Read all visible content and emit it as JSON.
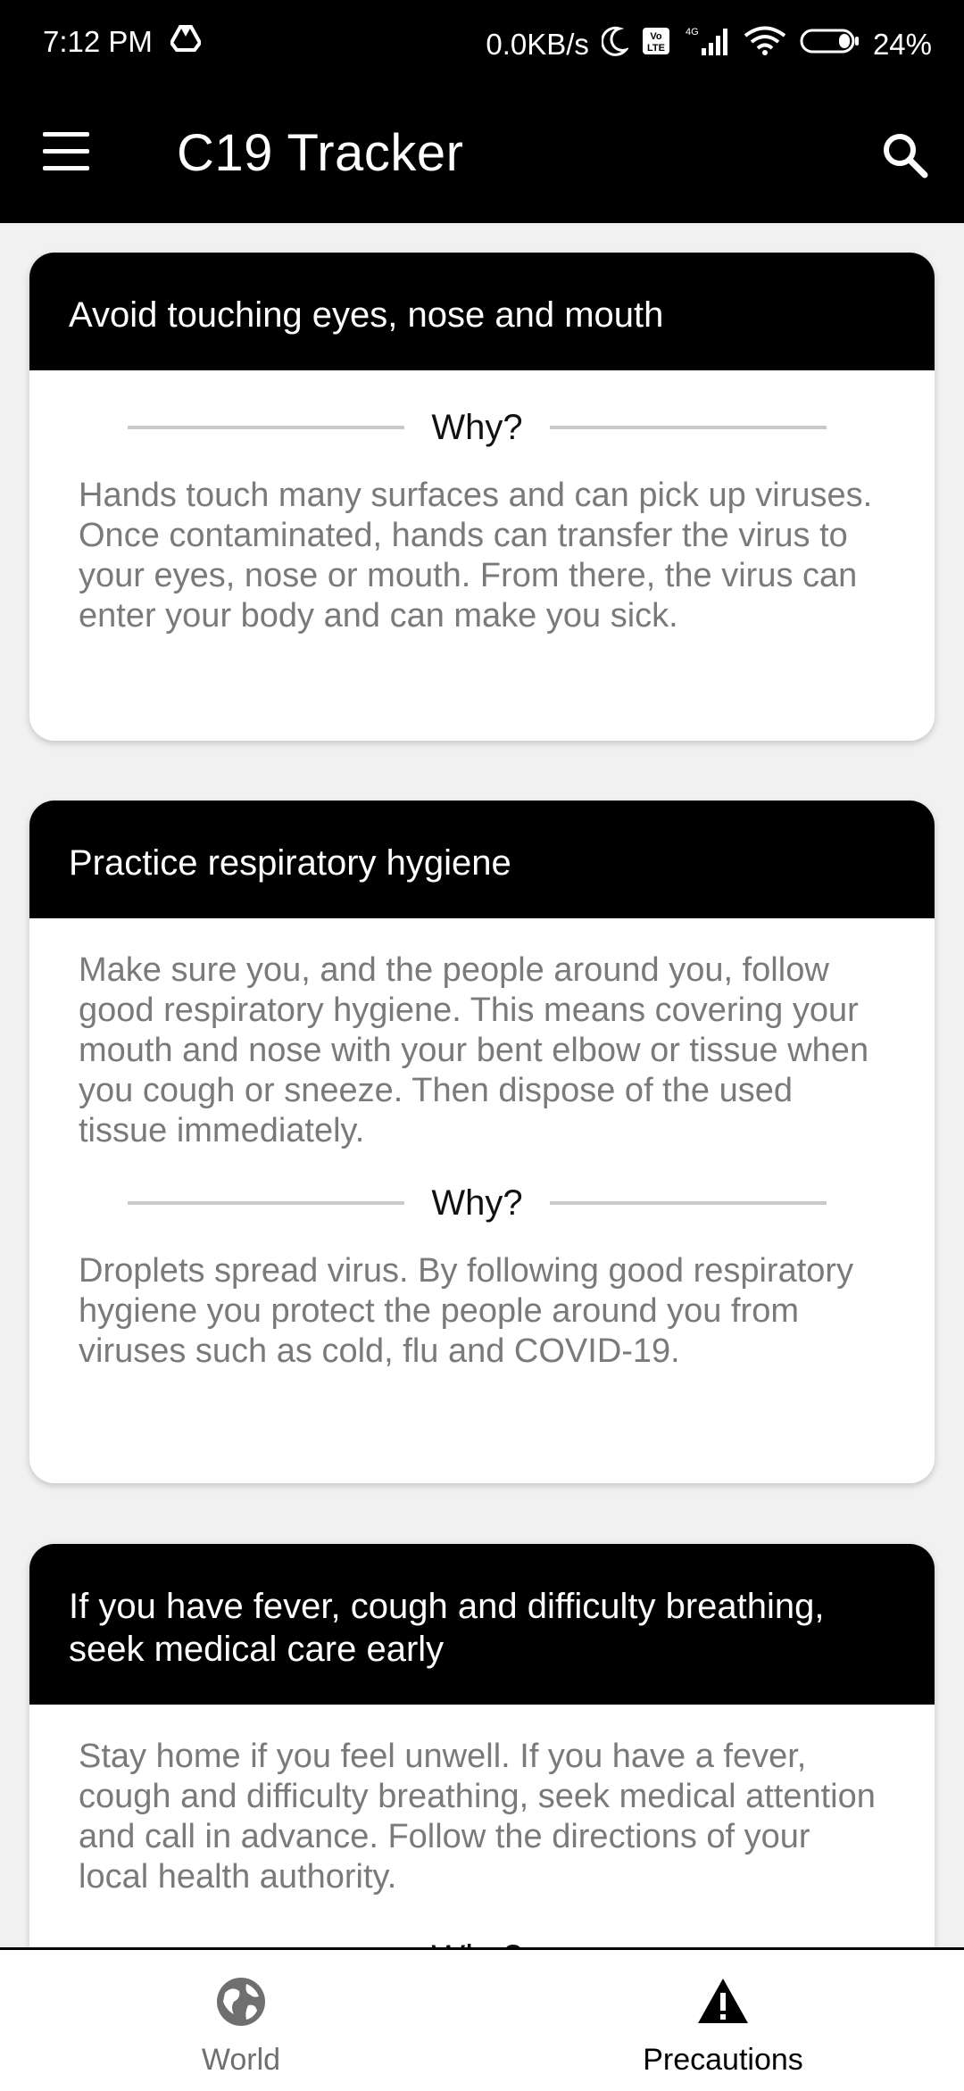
{
  "status_bar": {
    "time": "7:12 PM",
    "network_speed": "0.0KB/s",
    "battery": "24%",
    "icons": [
      "drive-icon",
      "moon-icon",
      "volte-icon",
      "signal-icon",
      "wifi-icon",
      "battery-icon"
    ]
  },
  "app_bar": {
    "title": "C19 Tracker",
    "menu_icon": "hamburger-menu-icon",
    "search_icon": "search-icon"
  },
  "cards": [
    {
      "title": "Avoid touching eyes, nose and mouth",
      "why_label": "Why?",
      "why_text": "Hands touch many surfaces and can pick up viruses. Once contaminated, hands can transfer the virus to your eyes, nose or mouth. From there, the virus can enter your body and can make you sick."
    },
    {
      "title": "Practice respiratory hygiene",
      "description": "Make sure you, and the people around you, follow good respiratory hygiene. This means covering your mouth and nose with your bent elbow or tissue when you cough or sneeze. Then dispose of the used tissue immediately.",
      "why_label": "Why?",
      "why_text": "Droplets spread virus. By following good respiratory hygiene you protect the people around you from viruses such as cold, flu and COVID-19."
    },
    {
      "title": "If you have fever, cough and difficulty breathing, seek medical care early",
      "description": "Stay home if you feel unwell. If you have a fever, cough and difficulty breathing, seek medical attention and call in advance. Follow the directions of your local health authority.",
      "why_label": "Why?"
    }
  ],
  "bottom_nav": {
    "items": [
      {
        "label": "World",
        "icon": "globe-icon",
        "active": false
      },
      {
        "label": "Precautions",
        "icon": "warning-icon",
        "active": true
      }
    ],
    "active_color": "#000000",
    "inactive_color": "#6f6f6f"
  }
}
